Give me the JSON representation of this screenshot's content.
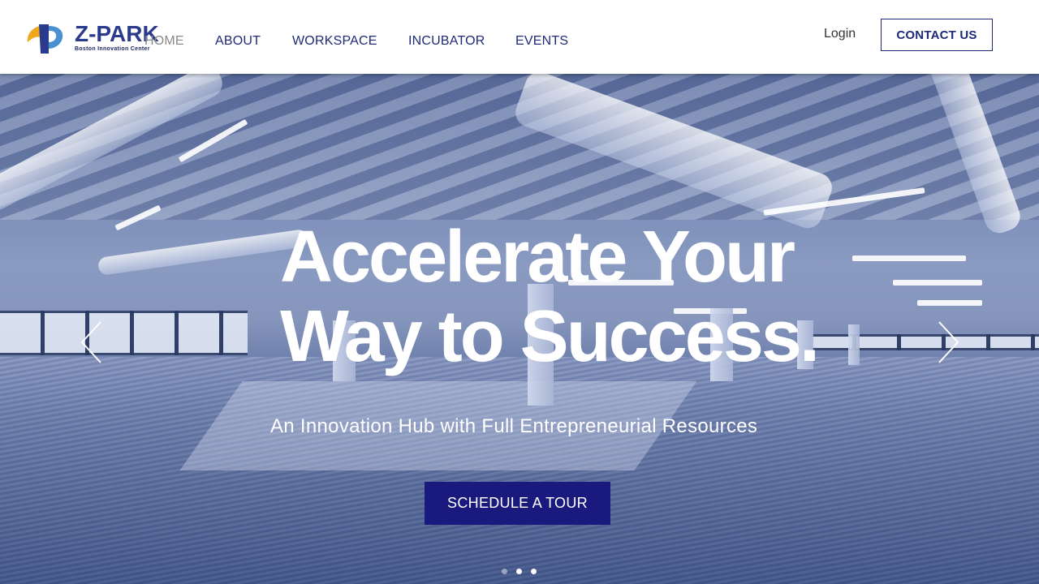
{
  "brand": {
    "name": "Z-PARK",
    "tagline": "Boston Innovation Center",
    "logo_colors": [
      "#f2a81d",
      "#2a3a8c",
      "#4a8fd0"
    ]
  },
  "nav": {
    "items": [
      {
        "label": "HOME",
        "active": true
      },
      {
        "label": "ABOUT"
      },
      {
        "label": "WORKSPACE"
      },
      {
        "label": "INCUBATOR"
      },
      {
        "label": "EVENTS"
      }
    ],
    "login_label": "Login",
    "contact_label": "CONTACT US"
  },
  "hero": {
    "headline_line1": "Accelerate Your",
    "headline_line2": "Way to Success.",
    "subheadline": "An Innovation Hub with Full Entrepreneurial Resources",
    "cta_label": "SCHEDULE A TOUR",
    "prev_icon": "chevron-left-icon",
    "next_icon": "chevron-right-icon",
    "slide_count": 3,
    "active_slide": 2
  },
  "colors": {
    "accent": "#1a1a7e",
    "nav_text": "#1e2a78",
    "nav_active": "#8a8a8a"
  }
}
